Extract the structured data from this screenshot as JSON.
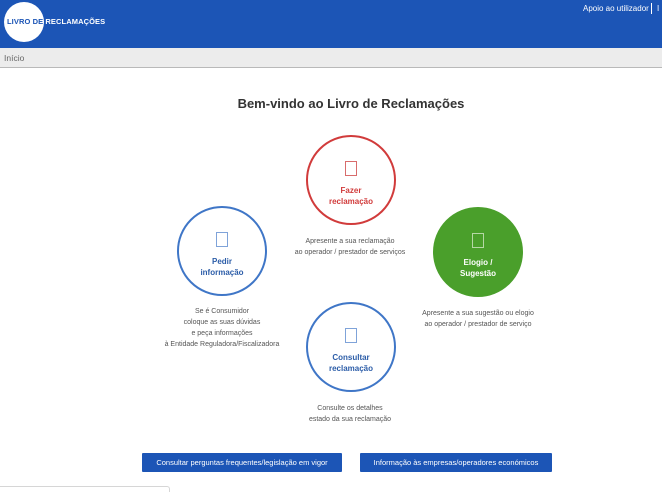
{
  "header": {
    "logo": {
      "part1": "LIVRO DE ",
      "part2": "RECLAMAÇÕES"
    },
    "support_link": "Apoio ao utilizador",
    "truncated_link": "I"
  },
  "breadcrumb": {
    "home": "Início"
  },
  "main": {
    "title": "Bem-vindo ao Livro de Reclamações",
    "actions": {
      "fazer": {
        "label_line1": "Fazer",
        "label_line2": "reclamação",
        "desc_line1": "Apresente a sua reclamação",
        "desc_line2": "ao operador / prestador de serviços"
      },
      "pedir": {
        "label_line1": "Pedir",
        "label_line2": "informação",
        "desc_line1": "Se é Consumidor",
        "desc_line2": "coloque as suas dúvidas",
        "desc_line3": "e peça informações",
        "desc_line4": "à Entidade Reguladora/Fiscalizadora"
      },
      "elogio": {
        "label_line1": "Elogio /",
        "label_line2": "Sugestão",
        "desc_line1": "Apresente a sua sugestão ou elogio",
        "desc_line2": "ao operador / prestador de serviço"
      },
      "consultar": {
        "label_line1": "Consultar",
        "label_line2": "reclamação",
        "desc_line1": "Consulte os detalhes",
        "desc_line2": "estado da sua reclamação"
      }
    },
    "buttons": {
      "faq": "Consultar perguntas frequentes/legislação em vigor",
      "info": "Informação às empresas/operadores económicos"
    }
  },
  "icons": {
    "fazer": "document-icon",
    "pedir": "document-icon",
    "elogio": "document-icon",
    "consultar": "document-icon"
  },
  "colors": {
    "header_blue": "#1c55b6",
    "complaint_red": "#d13b3b",
    "info_blue": "#3f76c7",
    "praise_green": "#4a9f2b"
  }
}
